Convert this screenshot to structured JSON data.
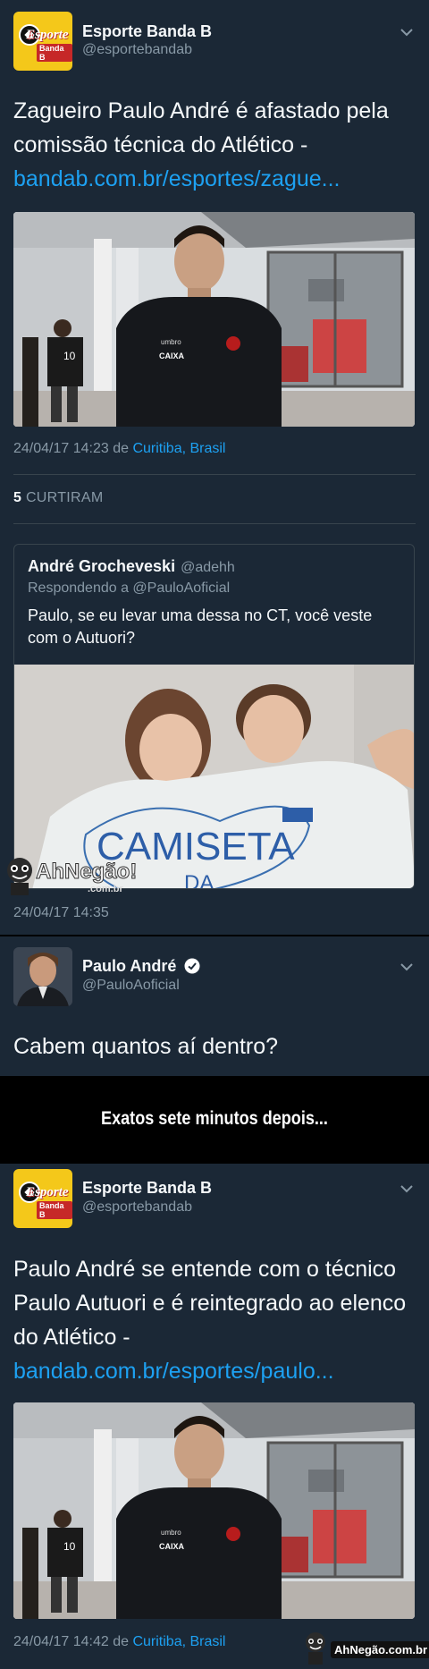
{
  "tweet1": {
    "name": "Esporte Banda B",
    "handle": "@esportebandab",
    "logo_text_1": "Esporte",
    "logo_text_2": "Banda B",
    "text": "Zagueiro Paulo André é afastado pela comissão técnica do Atlético - ",
    "link": "bandab.com.br/esportes/zague...",
    "timestamp": "24/04/17 14:23 de ",
    "location": "Curitiba, Brasil",
    "likes_count": "5",
    "likes_label": " CURTIRAM",
    "shirt_brand": "umbro",
    "shirt_sponsor": "CAIXA",
    "bg_shirt_number": "10"
  },
  "quote": {
    "name": "André Grocheveski",
    "handle": "@adehh",
    "reply_to": "Respondendo a @PauloAoficial",
    "text": "Paulo, se eu levar uma dessa no CT, você veste com o Autuori?",
    "shirt_text": "CAMISETA",
    "shirt_text_2": "DA",
    "timestamp": "24/04/17 14:35"
  },
  "tweet2": {
    "name": "Paulo André",
    "handle": "@PauloAoficial",
    "text": "Cabem quantos aí dentro?"
  },
  "band": {
    "text": "Exatos sete minutos depois..."
  },
  "tweet3": {
    "name": "Esporte Banda B",
    "handle": "@esportebandab",
    "text": "Paulo André se entende com o técnico Paulo Autuori e é reintegrado ao elenco do Atlético - ",
    "link": "bandab.com.br/esportes/paulo...",
    "timestamp": "24/04/17 14:42 de ",
    "location": "Curitiba, Brasil",
    "shirt_brand": "umbro",
    "shirt_sponsor": "CAIXA",
    "bg_shirt_number": "10"
  },
  "watermarks": {
    "mid_brand": "AhNegão!",
    "mid_domain": ".com.br",
    "footer_brand": "AhNegão.com.br"
  },
  "colors": {
    "background": "#1b2836",
    "link": "#1da1f2",
    "muted": "#8899a6",
    "logo_yellow": "#f4c81a",
    "band": "#000000"
  },
  "icons": [
    "chevron-down-icon",
    "verified-badge-icon"
  ]
}
